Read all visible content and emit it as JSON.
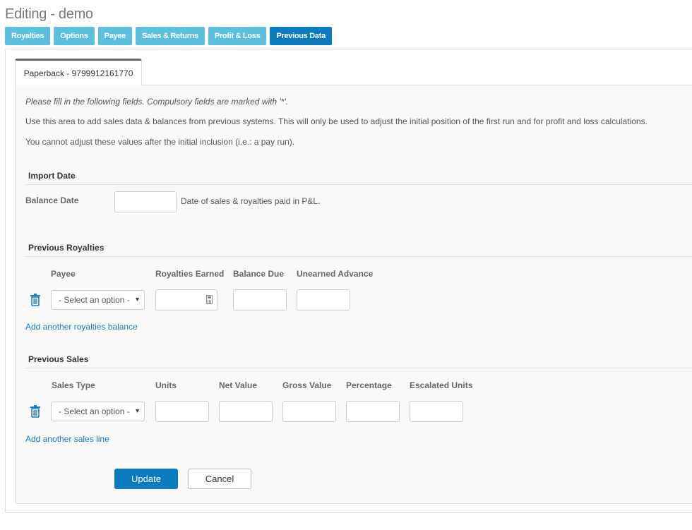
{
  "page": {
    "title": "Editing - demo"
  },
  "nav": {
    "tabs": [
      {
        "label": "Royalties"
      },
      {
        "label": "Options"
      },
      {
        "label": "Payee"
      },
      {
        "label": "Sales & Returns"
      },
      {
        "label": "Profit & Loss"
      },
      {
        "label": "Previous Data",
        "active": true
      }
    ]
  },
  "product_tab": {
    "label": "Paperback - 9799912161770"
  },
  "intro": {
    "line1": "Please fill in the following fields. Compulsory fields are marked with '*'.",
    "line2": "Use this area to add sales data & balances from previous systems. This will only be used to adjust the initial position of the first run and for profit and loss calculations.",
    "line3": "You cannot adjust these values after the initial inclusion (i.e.: a pay run)."
  },
  "import_date": {
    "heading": "Import Date",
    "balance_date_label": "Balance Date",
    "balance_date_value": "",
    "balance_date_help": "Date of sales & royalties paid in P&L."
  },
  "previous_royalties": {
    "heading": "Previous Royalties",
    "columns": [
      "Payee",
      "Royalties Earned",
      "Balance Due",
      "Unearned Advance"
    ],
    "row": {
      "payee_select": "- Select an option -",
      "royalties_earned": "",
      "balance_due": "",
      "unearned_advance": ""
    },
    "add_link": "Add another royalties balance"
  },
  "previous_sales": {
    "heading": "Previous Sales",
    "columns": [
      "Sales Type",
      "Units",
      "Net Value",
      "Gross Value",
      "Percentage",
      "Escalated Units"
    ],
    "row": {
      "sales_type_select": "- Select an option -",
      "units": "",
      "net_value": "",
      "gross_value": "",
      "percentage": "",
      "escalated_units": ""
    },
    "add_link": "Add another sales line"
  },
  "actions": {
    "update_label": "Update",
    "cancel_label": "Cancel"
  },
  "colors": {
    "accent": "#0a7bbf",
    "nav_tab": "#5bc0de",
    "link": "#1a7bbf"
  },
  "icons": {
    "delete": "trash-icon",
    "dropdown": "caret-down-icon",
    "calculator": "calculator-icon"
  }
}
